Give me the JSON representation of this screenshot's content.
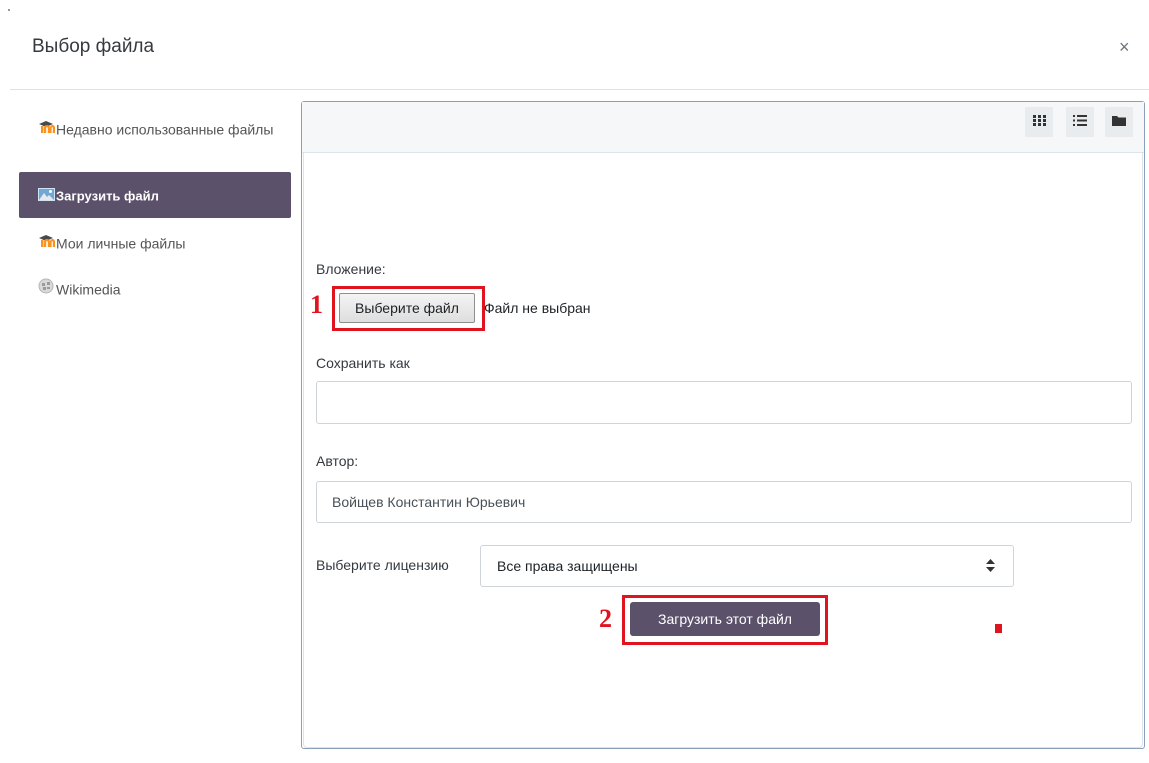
{
  "dialog": {
    "title": "Выбор файла",
    "close_symbol": "×"
  },
  "sidebar": {
    "items": [
      {
        "label": "Недавно использованные файлы",
        "icon": "moodle-icon",
        "active": false
      },
      {
        "label": "Загрузить файл",
        "icon": "upload-icon",
        "active": true
      },
      {
        "label": "Мои личные файлы",
        "icon": "moodle-icon",
        "active": false
      },
      {
        "label": "Wikimedia",
        "icon": "wikimedia-icon",
        "active": false
      }
    ]
  },
  "toolbar": {
    "views": [
      "grid-view-icon",
      "list-view-icon",
      "folder-view-icon"
    ]
  },
  "form": {
    "attachment_label": "Вложение:",
    "choose_file_button": "Выберите файл",
    "file_status": "Файл не выбран",
    "save_as_label": "Сохранить как",
    "save_as_value": "",
    "author_label": "Автор:",
    "author_value": "Войщев Константин Юрьевич",
    "license_label": "Выберите лицензию",
    "license_value": "Все права защищены",
    "upload_button": "Загрузить этот файл"
  },
  "annotations": {
    "marker_1": "1",
    "marker_2": "2"
  },
  "colors": {
    "accent": "#5b516b",
    "annotation": "#e0141e",
    "panel_border": "#8aa0b8"
  }
}
